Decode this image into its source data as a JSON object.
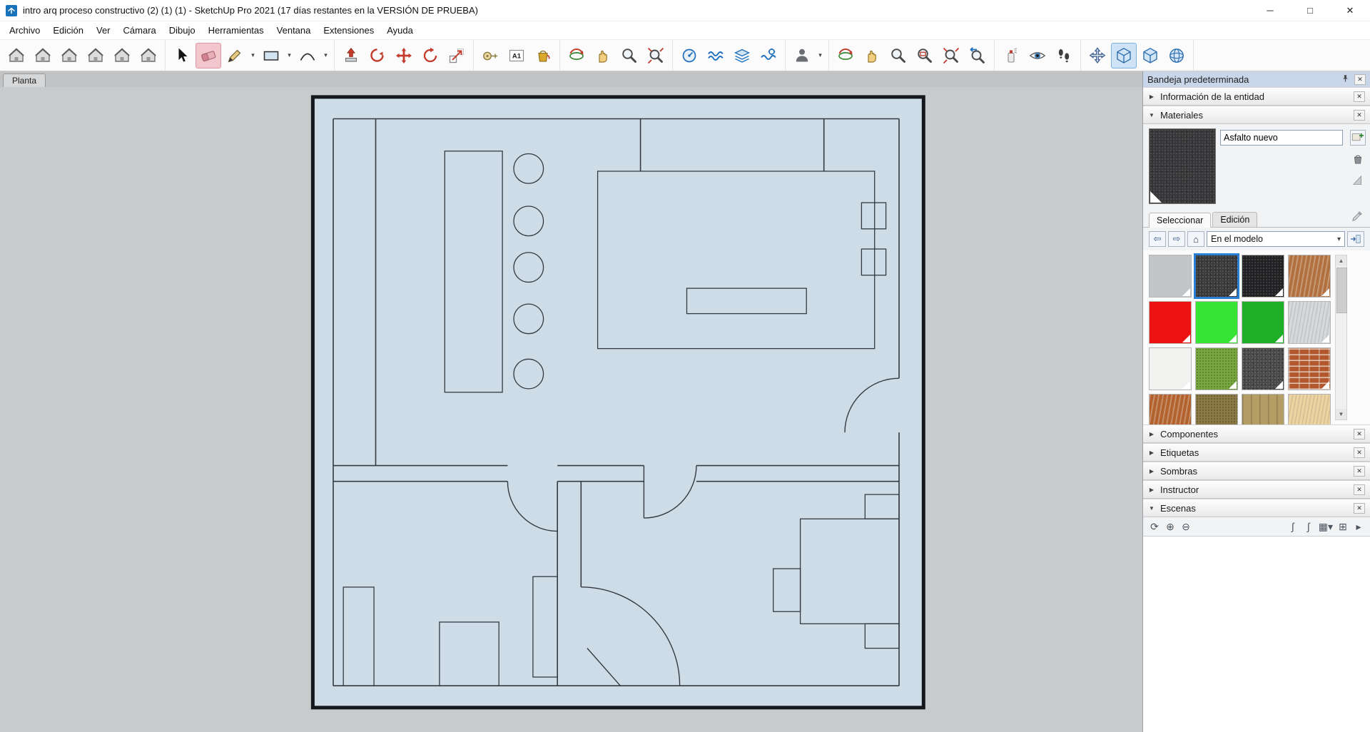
{
  "window": {
    "title": "intro arq proceso constructivo (2) (1) (1) - SketchUp Pro 2021 (17 días restantes en la VERSIÓN DE PRUEBA)"
  },
  "icons": {
    "minimize": "─",
    "maximize": "□",
    "close": "✕",
    "collapsed": "▶",
    "expanded": "▼",
    "dropdown": "▾",
    "back": "⇦",
    "forward": "⇨",
    "home": "⌂",
    "scroll_up": "▲",
    "scroll_down": "▼"
  },
  "menu": {
    "items": [
      "Archivo",
      "Edición",
      "Ver",
      "Cámara",
      "Dibujo",
      "Herramientas",
      "Ventana",
      "Extensiones",
      "Ayuda"
    ]
  },
  "toolbar": {
    "groups": [
      [
        {
          "name": "view-iso-button",
          "type": "house"
        },
        {
          "name": "view-top-button",
          "type": "house"
        },
        {
          "name": "view-front-button",
          "type": "house"
        },
        {
          "name": "view-right-button",
          "type": "house"
        },
        {
          "name": "view-back-button",
          "type": "house"
        },
        {
          "name": "view-left-button",
          "type": "house"
        }
      ],
      [
        {
          "name": "select-tool-button",
          "type": "cursor"
        },
        {
          "name": "eraser-tool-button",
          "type": "eraser",
          "active": "pink"
        },
        {
          "name": "line-tool-button",
          "type": "pencil",
          "dropdown": true
        },
        {
          "name": "shapes-tool-button",
          "type": "rect",
          "dropdown": true
        },
        {
          "name": "arc-tool-button",
          "type": "arc",
          "dropdown": true
        }
      ],
      [
        {
          "name": "push-pull-button",
          "type": "pushpull"
        },
        {
          "name": "follow-me-button",
          "type": "followme"
        },
        {
          "name": "move-tool-button",
          "type": "move"
        },
        {
          "name": "rotate-tool-button",
          "type": "rotate"
        },
        {
          "name": "scale-tool-button",
          "type": "scale"
        }
      ],
      [
        {
          "name": "tape-measure-button",
          "type": "tape"
        },
        {
          "name": "text-tool-button",
          "type": "a1"
        },
        {
          "name": "paint-bucket-button",
          "type": "bucket"
        }
      ],
      [
        {
          "name": "orbit-button",
          "type": "orbit"
        },
        {
          "name": "pan-button",
          "type": "hand"
        },
        {
          "name": "zoom-button",
          "type": "zoom"
        },
        {
          "name": "zoom-extents-button",
          "type": "zoomext"
        }
      ],
      [
        {
          "name": "sandbox-gauge-button",
          "type": "gauge"
        },
        {
          "name": "sandbox-contours-button",
          "type": "waves"
        },
        {
          "name": "sandbox-layers-button",
          "type": "layers"
        },
        {
          "name": "sandbox-modify-button",
          "type": "wavegear"
        }
      ],
      [
        {
          "name": "user-camera-button",
          "type": "person",
          "dropdown": true
        }
      ],
      [
        {
          "name": "orbit-2-button",
          "type": "orbit"
        },
        {
          "name": "pan-2-button",
          "type": "hand"
        },
        {
          "name": "zoom-2-button",
          "type": "zoom"
        },
        {
          "name": "zoom-window-button",
          "type": "zoomwin"
        },
        {
          "name": "zoom-extents-2-button",
          "type": "zoomext"
        },
        {
          "name": "zoom-previous-button",
          "type": "zoomprev"
        }
      ],
      [
        {
          "name": "position-camera-button",
          "type": "spray"
        },
        {
          "name": "look-around-button",
          "type": "eye"
        },
        {
          "name": "walk-button",
          "type": "feet"
        }
      ],
      [
        {
          "name": "navigation-cross-button",
          "type": "navcross"
        },
        {
          "name": "iso-cube-button",
          "type": "cube",
          "active": "blue"
        },
        {
          "name": "box-view-button",
          "type": "cube"
        },
        {
          "name": "sphere-view-button",
          "type": "sphere"
        }
      ]
    ]
  },
  "canvas": {
    "scene_tab": "Planta"
  },
  "tray": {
    "title": "Bandeja predeterminada",
    "sections": [
      {
        "label": "Información de la entidad",
        "expanded": false
      },
      {
        "label": "Materiales",
        "expanded": true
      },
      {
        "label": "Componentes",
        "expanded": false
      },
      {
        "label": "Etiquetas",
        "expanded": false
      },
      {
        "label": "Sombras",
        "expanded": false
      },
      {
        "label": "Instructor",
        "expanded": false
      },
      {
        "label": "Escenas",
        "expanded": true
      }
    ]
  },
  "materials": {
    "name_value": "Asfalto nuevo",
    "tab_select": "Seleccionar",
    "tab_edit": "Edición",
    "dropdown_value": "En el modelo",
    "swatches": [
      {
        "color": "#c3c6c9"
      },
      {
        "color": "#3b3b3d",
        "speckle": true,
        "selected": true
      },
      {
        "color": "#232325",
        "speckle": true
      },
      {
        "color": "#b0703f",
        "pattern": "streak"
      },
      {
        "color": "#ee1212"
      },
      {
        "color": "#35e435"
      },
      {
        "color": "#1fae27"
      },
      {
        "color": "#d7d8da",
        "pattern": "streak-light"
      },
      {
        "color": "#f2f2f0"
      },
      {
        "color": "#78a73f",
        "pattern": "grass"
      },
      {
        "color": "#4a4a4a",
        "speckle": true
      },
      {
        "color": "#b3572e",
        "pattern": "brick"
      },
      {
        "color": "#b2622e",
        "pattern": "streak"
      },
      {
        "color": "#8b7a46",
        "pattern": "grass"
      },
      {
        "color": "#b49e66",
        "pattern": "planks"
      },
      {
        "color": "#ecd3a0",
        "pattern": "streak-light"
      }
    ]
  },
  "scenes": {
    "buttons": [
      {
        "name": "update-scenes-button",
        "glyph": "⟳",
        "side": "left"
      },
      {
        "name": "add-scene-button",
        "glyph": "⊕",
        "side": "left"
      },
      {
        "name": "remove-scene-button",
        "glyph": "⊖",
        "side": "left"
      },
      {
        "name": "move-scene-down-button",
        "glyph": "∫",
        "side": "right"
      },
      {
        "name": "move-scene-up-button",
        "glyph": "∫",
        "side": "right"
      },
      {
        "name": "view-options-button",
        "glyph": "▦▾",
        "side": "right"
      },
      {
        "name": "add-thumbnail-button",
        "glyph": "⊞",
        "side": "right"
      },
      {
        "name": "scene-details-button",
        "glyph": "▸",
        "side": "right"
      }
    ]
  }
}
